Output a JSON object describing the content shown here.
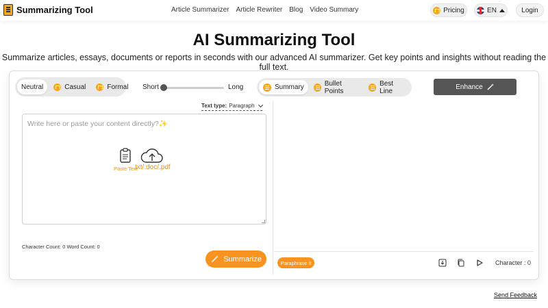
{
  "header": {
    "brand": "Summarizing Tool",
    "nav": [
      "Article Summarizer",
      "Article Rewriter",
      "Blog",
      "Video Summary"
    ],
    "pricing": "Pricing",
    "lang": "EN",
    "login": "Login"
  },
  "hero": {
    "title": "AI Summarizing Tool",
    "subtitle": "Summarize articles, essays, documents or reports in seconds with our advanced AI summarizer. Get key points and insights without reading the full text."
  },
  "controls": {
    "tones": [
      "Neutral",
      "Casual",
      "Formal"
    ],
    "active_tone": "Neutral",
    "length_short": "Short",
    "length_long": "Long",
    "length_value": 0,
    "modes": [
      "Summary",
      "Bullet Points",
      "Best Line"
    ],
    "active_mode": "Summary",
    "enhance": "Enhance"
  },
  "input": {
    "text_type_label": "Text type:",
    "text_type_value": "Paragraph",
    "placeholder": "Write here or paste your content directly?✨",
    "paste_label": "Paste Text",
    "upload_label": "txt/.doc/.pdf",
    "counts": "Character Count: 0 Word Count: 0",
    "summarize": "Summarize"
  },
  "output": {
    "paraphrase": "Paraphrase it",
    "character": "Character : 0"
  },
  "footer": {
    "feedback": "Send Feedback"
  },
  "colors": {
    "accent": "#f7931e",
    "enhance_bg": "#555555"
  }
}
